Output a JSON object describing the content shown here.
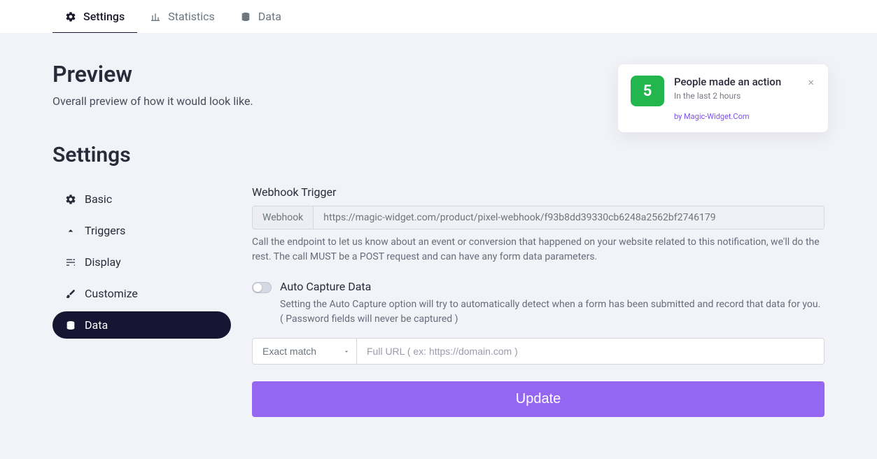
{
  "tabs": [
    {
      "label": "Settings"
    },
    {
      "label": "Statistics"
    },
    {
      "label": "Data"
    }
  ],
  "preview": {
    "title": "Preview",
    "subtitle": "Overall preview of how it would look like."
  },
  "notification": {
    "count": "5",
    "title": "People made an action",
    "subtitle": "In the last 2 hours",
    "by": "by Magic-Widget.Com"
  },
  "settings": {
    "title": "Settings",
    "sidebar": [
      {
        "label": "Basic"
      },
      {
        "label": "Triggers"
      },
      {
        "label": "Display"
      },
      {
        "label": "Customize"
      },
      {
        "label": "Data"
      }
    ],
    "webhook": {
      "label": "Webhook Trigger",
      "addon": "Webhook",
      "value": "https://magic-widget.com/product/pixel-webhook/f93b8dd39330cb6248a2562bf2746179",
      "help": "Call the endpoint to let us know about an event or conversion that happened on your website related to this notification, we'll do the rest. The call MUST be a POST request and can have any form data parameters."
    },
    "autoCapture": {
      "label": "Auto Capture Data",
      "help": "Setting the Auto Capture option will try to automatically detect when a form has been submitted and record that data for you. ( Password fields will never be captured )"
    },
    "matchRow": {
      "select": "Exact match",
      "inputPlaceholder": "Full URL ( ex: https://domain.com )"
    },
    "updateButton": "Update"
  }
}
